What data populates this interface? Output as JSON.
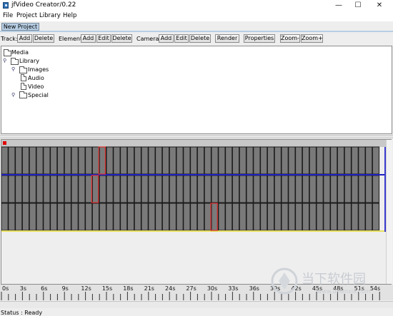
{
  "window": {
    "title": "jfVideo Creator/0.22",
    "controls": {
      "minimize": "—",
      "maximize": "☐",
      "close": "✕"
    }
  },
  "menubar": {
    "items": [
      "File",
      "Project",
      "Library",
      "Help"
    ]
  },
  "tab": {
    "label": "New Project"
  },
  "toolbar": {
    "track_label": "Track:",
    "track_add": "Add",
    "track_delete": "Delete",
    "element_label": "Element:",
    "element_add": "Add",
    "element_edit": "Edit",
    "element_delete": "Delete",
    "camera_label": "Camera:",
    "camera_add": "Add",
    "camera_edit": "Edit",
    "camera_delete": "Delete",
    "render": "Render",
    "properties": "Properties",
    "zoom_out": "Zoom-",
    "zoom_in": "Zoom+"
  },
  "tree": {
    "root": "Media",
    "library": "Library",
    "children": [
      "Images",
      "Audio",
      "Video",
      "Special"
    ]
  },
  "timeline": {
    "ruler_labels": [
      "0s",
      "3s",
      "6s",
      "9s",
      "12s",
      "15s",
      "18s",
      "21s",
      "24s",
      "27s",
      "30s",
      "33s",
      "36s",
      "39s",
      "42s",
      "45s",
      "48s",
      "51s",
      "54s"
    ],
    "colors": {
      "cell": "#7a7a7a",
      "cell_border": "#1a1a1a",
      "playhead_bar": "#c8c8c8",
      "marker": "#e00000",
      "selected_outline": "#e03030",
      "track_separator_blue": "#2020c0",
      "track_separator_yellow": "#e8e060"
    }
  },
  "status": {
    "text": "Status : Ready"
  },
  "watermark": {
    "text": "当下软件园",
    "sub": "www.downxia.com"
  }
}
